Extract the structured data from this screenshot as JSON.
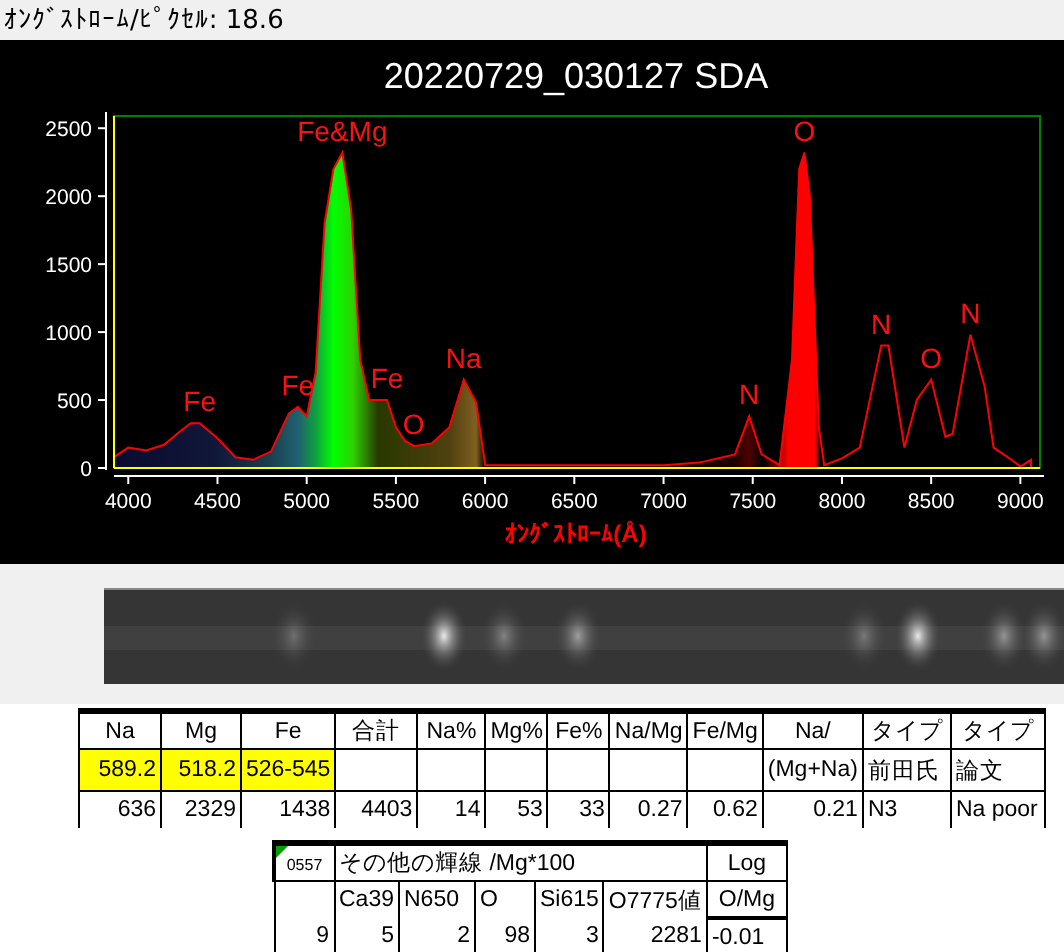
{
  "header": {
    "label": "ｵﾝｸﾞｽﾄﾛｰﾑ/ﾋﾟｸｾﾙ: 18.6"
  },
  "chart": {
    "title": "20220729_030127 SDA",
    "chart_data": {
      "type": "area",
      "xlabel": "ｵﾝｸﾞｽﾄﾛｰﾑ(Å)",
      "x": [
        3920,
        4000,
        4100,
        4200,
        4300,
        4350,
        4400,
        4500,
        4600,
        4700,
        4800,
        4900,
        4950,
        5000,
        5050,
        5100,
        5150,
        5200,
        5250,
        5300,
        5350,
        5400,
        5450,
        5500,
        5550,
        5600,
        5700,
        5800,
        5880,
        5950,
        6000,
        6100,
        6500,
        7000,
        7200,
        7400,
        7480,
        7550,
        7650,
        7720,
        7760,
        7790,
        7820,
        7870,
        7900,
        8000,
        8100,
        8220,
        8260,
        8350,
        8420,
        8500,
        8580,
        8620,
        8720,
        8800,
        8850,
        8950,
        9000,
        9060
      ],
      "series": [
        {
          "color": "#ff0000",
          "values": [
            80,
            150,
            130,
            170,
            280,
            330,
            330,
            220,
            80,
            60,
            120,
            400,
            450,
            380,
            700,
            1800,
            2200,
            2320,
            1900,
            800,
            500,
            500,
            500,
            300,
            200,
            160,
            180,
            300,
            650,
            480,
            20,
            20,
            20,
            20,
            40,
            100,
            380,
            100,
            20,
            800,
            2200,
            2320,
            2000,
            300,
            20,
            70,
            150,
            900,
            900,
            150,
            500,
            650,
            230,
            250,
            980,
            600,
            150,
            60,
            10,
            60
          ]
        }
      ],
      "xlim": [
        3920,
        9110
      ],
      "ylim": [
        0,
        2590
      ],
      "xticks": [
        4000,
        4500,
        5000,
        5500,
        6000,
        6500,
        7000,
        7500,
        8000,
        8500,
        9000
      ],
      "yticks": [
        0,
        500,
        1000,
        1500,
        2000,
        2500
      ],
      "annotations": [
        {
          "x": 4400,
          "y": 330,
          "text": "Fe"
        },
        {
          "x": 4950,
          "y": 450,
          "text": "Fe"
        },
        {
          "x": 5200,
          "y": 2320,
          "text": "Fe&Mg"
        },
        {
          "x": 5450,
          "y": 500,
          "text": "Fe"
        },
        {
          "x": 5600,
          "y": 160,
          "text": "O"
        },
        {
          "x": 5880,
          "y": 650,
          "text": "Na"
        },
        {
          "x": 7480,
          "y": 380,
          "text": "N"
        },
        {
          "x": 7790,
          "y": 2320,
          "text": "O"
        },
        {
          "x": 8220,
          "y": 900,
          "text": "N"
        },
        {
          "x": 8500,
          "y": 650,
          "text": "O"
        },
        {
          "x": 8720,
          "y": 980,
          "text": "N"
        }
      ]
    }
  },
  "table": {
    "rows": [
      [
        {
          "text": "Na",
          "highlighted": false
        },
        {
          "text": "Mg",
          "highlighted": false
        },
        {
          "text": "Fe",
          "highlighted": false
        },
        {
          "text": "合計",
          "highlighted": false
        },
        {
          "text": "Na%",
          "highlighted": false
        },
        {
          "text": "Mg%",
          "highlighted": false
        },
        {
          "text": "Fe%",
          "highlighted": false
        },
        {
          "text": "Na/Mg",
          "highlighted": false
        },
        {
          "text": "Fe/Mg",
          "highlighted": false
        },
        {
          "text": "Na/",
          "highlighted": false
        },
        {
          "text": "タイプ",
          "highlighted": false
        },
        {
          "text": "タイプ",
          "highlighted": false
        }
      ],
      [
        {
          "text": "589.2",
          "highlighted": true
        },
        {
          "text": "518.2",
          "highlighted": true
        },
        {
          "text": "526-545",
          "highlighted": true
        },
        {
          "highlighted": false
        },
        {
          "highlighted": false
        },
        {
          "highlighted": false
        },
        {
          "highlighted": false
        },
        {
          "highlighted": false
        },
        {
          "highlighted": false
        },
        {
          "text": "(Mg+Na)",
          "highlighted": false
        },
        {
          "text": "前田氏",
          "highlighted": false
        },
        {
          "text": "論文",
          "highlighted": false
        }
      ],
      [
        {
          "text": "636",
          "highlighted": false
        },
        {
          "text": "2329",
          "highlighted": false
        },
        {
          "text": "1438",
          "highlighted": false
        },
        {
          "text": "4403",
          "highlighted": false
        },
        {
          "text": "14",
          "highlighted": false
        },
        {
          "text": "53",
          "highlighted": false
        },
        {
          "text": "33",
          "highlighted": false
        },
        {
          "text": "0.27",
          "highlighted": false
        },
        {
          "text": "0.62",
          "highlighted": false
        },
        {
          "text": "0.21",
          "highlighted": false
        },
        {
          "text": "N3",
          "highlighted": false
        },
        {
          "text": "Na poor",
          "highlighted": false
        }
      ]
    ]
  },
  "table2": {
    "id_cell": "0557",
    "has_comment": true,
    "title": "その他の輝線 /Mg*100",
    "log_header": "Log",
    "columns": [
      "Ca39",
      "N650",
      "O",
      "Si615",
      "O7775値",
      "O/Mg"
    ],
    "values": [
      "9",
      "5",
      "2",
      "98",
      "3",
      "2281",
      "-0.01"
    ]
  }
}
